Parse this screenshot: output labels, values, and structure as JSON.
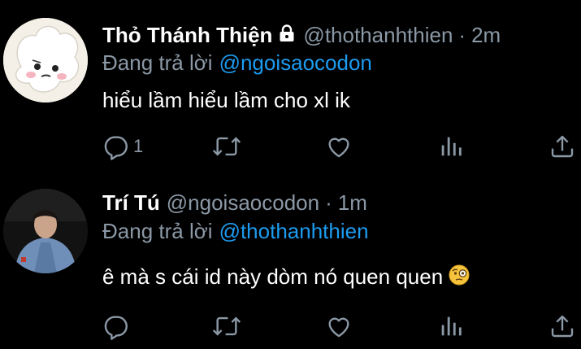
{
  "tweets": [
    {
      "display_name": "Thỏ Thánh Thiện",
      "handle": "@thothanhthien",
      "separator": "·",
      "time": "2m",
      "protected": true,
      "reply_label": "Đang trả lời",
      "reply_to": "@ngoisaocodon",
      "text": "hiểu lầm hiểu lầm cho xl ik",
      "reply_count": "1"
    },
    {
      "display_name": "Trí Tú",
      "handle": "@ngoisaocodon",
      "separator": "·",
      "time": "1m",
      "protected": false,
      "reply_label": "Đang trả lời",
      "reply_to": "@thothanhthien",
      "text": "ê mà s cái id này dòm nó quen quen",
      "emoji": "face-with-monocle",
      "reply_count": ""
    }
  ],
  "colors": {
    "background": "#000000",
    "text": "#ffffff",
    "secondary": "#8b98a5",
    "link": "#1d9bf0"
  },
  "icons": [
    "reply-icon",
    "retweet-icon",
    "like-icon",
    "views-icon",
    "share-icon",
    "lock-icon"
  ]
}
